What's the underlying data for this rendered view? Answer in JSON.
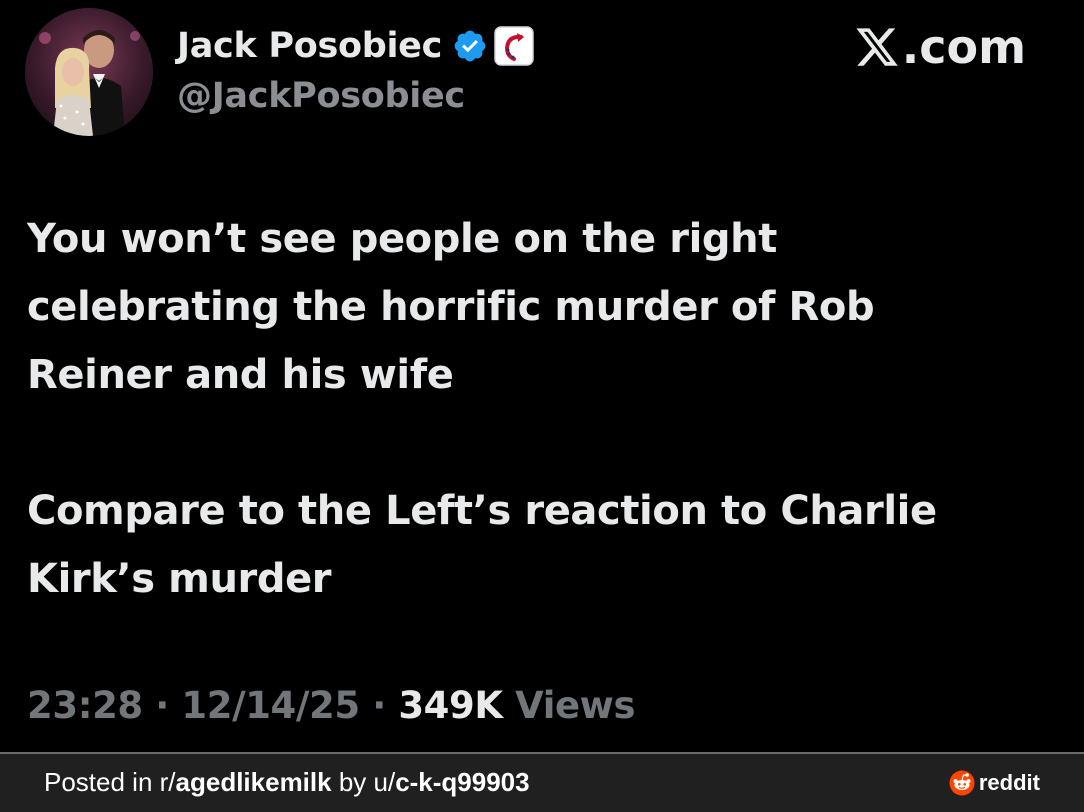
{
  "post": {
    "display_name": "Jack Posobiec",
    "handle": "@JackPosobiec",
    "brand": ".com",
    "paragraphs": [
      [
        "You won’t see people on the right",
        "celebrating the horrific murder of Rob",
        "Reiner and his wife"
      ],
      [
        "Compare to the Left’s reaction to Charlie",
        "Kirk’s murder"
      ]
    ],
    "time": "23:28",
    "date": "12/14/25",
    "separator": "·",
    "views_count": "349K",
    "views_label": "Views"
  },
  "footer": {
    "posted_in_prefix": "Posted in r/",
    "subreddit": "agedlikemilk",
    "by_prefix": " by u/",
    "username": "c-k-q99903",
    "reddit_label": "reddit"
  },
  "colors": {
    "background": "#000000",
    "text_primary": "#e7e9ea",
    "text_secondary": "#71767b",
    "verified_blue": "#1d9bf0",
    "footer_bg": "#202020",
    "reddit_orange": "#ff4500"
  },
  "icons": {
    "verified": "verified-badge-icon",
    "affiliation": "affiliate-logo-icon",
    "brand": "x-logo-icon",
    "reddit": "reddit-snoo-icon"
  }
}
